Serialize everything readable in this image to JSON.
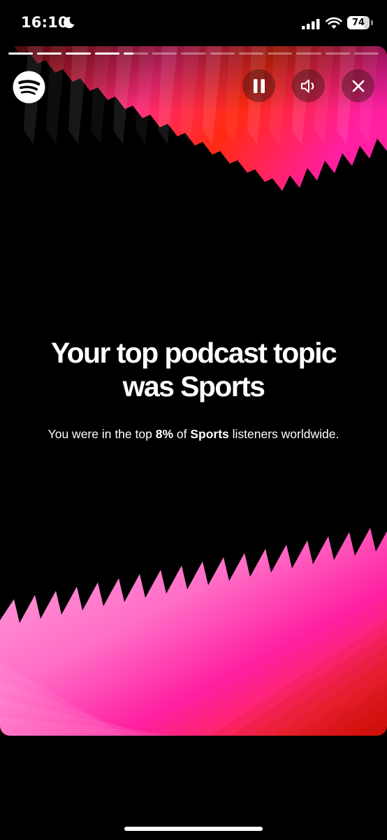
{
  "status_bar": {
    "time": "16:10",
    "battery_level": "74",
    "battery_fraction": 0.74
  },
  "story": {
    "segment_count": 13,
    "current_segment": 5,
    "current_segment_progress": 0.4,
    "headline_line1": "Your top podcast topic",
    "headline_line2": "was Sports",
    "subtitle": {
      "prefix": "You were in the top ",
      "percent": "8%",
      "middle": " of ",
      "topic": "Sports",
      "suffix": " listeners worldwide."
    },
    "controls": {
      "pause_icon": "pause-icon",
      "sound_icon": "speaker-icon",
      "close_icon": "close-icon"
    },
    "colors": {
      "background": "#000000",
      "magenta": "#ff1fa0",
      "pink": "#ff7fcf",
      "red": "#ff2a12"
    },
    "logo": "spotify-logo"
  }
}
